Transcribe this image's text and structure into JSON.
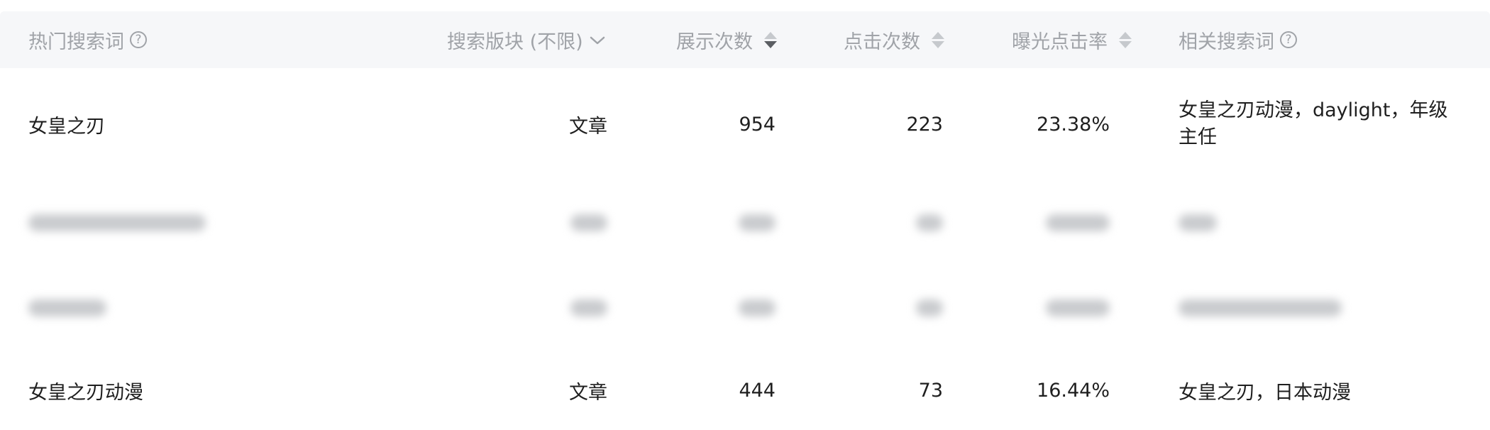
{
  "table": {
    "headers": {
      "keyword": "热门搜索词",
      "section": "搜索版块 (不限)",
      "impressions": "展示次数",
      "clicks": "点击次数",
      "ctr": "曝光点击率",
      "related": "相关搜索词"
    },
    "help_glyph": "?",
    "rows": [
      {
        "keyword": "女皇之刃",
        "section": "文章",
        "impressions": "954",
        "clicks": "223",
        "ctr": "23.38%",
        "related": "女皇之刃动漫，daylight，年级主任"
      },
      {
        "keyword": "女皇之刃动漫",
        "section": "文章",
        "impressions": "444",
        "clicks": "73",
        "ctr": "16.44%",
        "related": "女皇之刃，日本动漫"
      }
    ]
  }
}
